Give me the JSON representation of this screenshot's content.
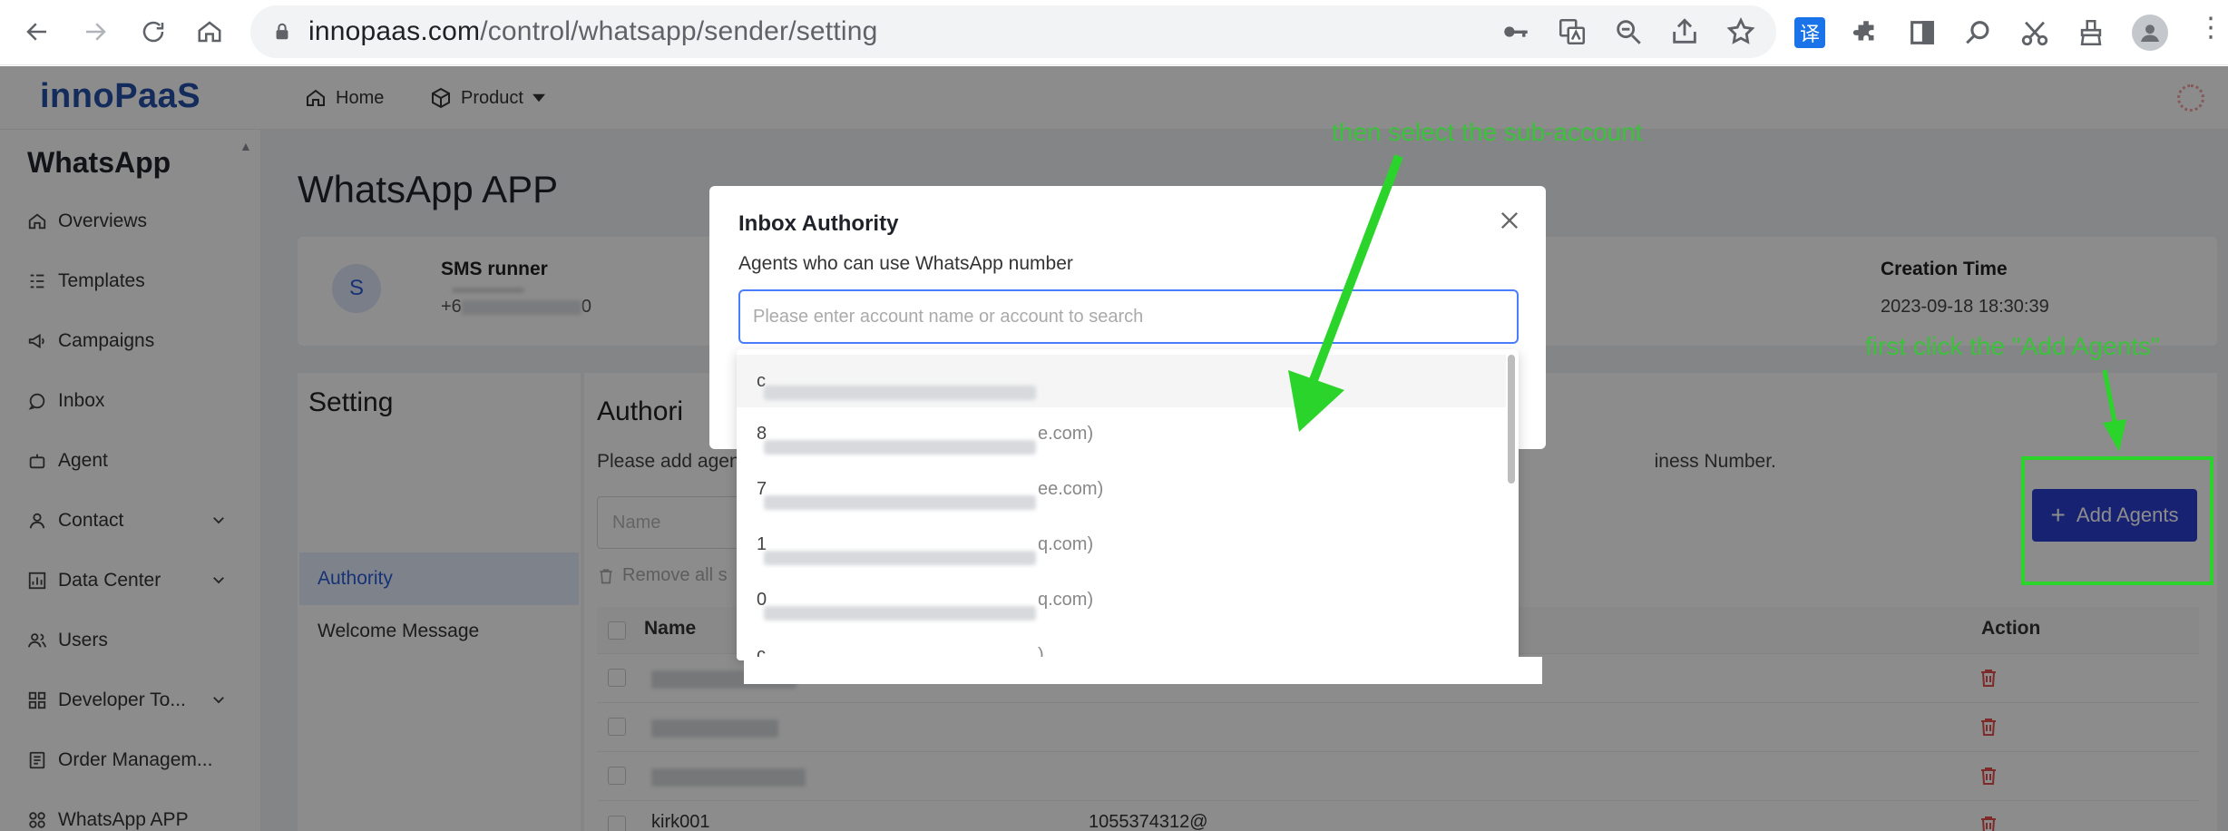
{
  "browser": {
    "url_domain": "innopaas.com",
    "url_path": "/control/whatsapp/sender/setting",
    "translate_badge": "译",
    "menu_glyph": "⋮"
  },
  "header": {
    "logo": "innoPaaS",
    "nav_home": "Home",
    "nav_product": "Product"
  },
  "sidebar": {
    "title": "WhatsApp",
    "items": [
      {
        "label": "Overviews",
        "icon": "home-icon"
      },
      {
        "label": "Templates",
        "icon": "template-icon"
      },
      {
        "label": "Campaigns",
        "icon": "megaphone-icon"
      },
      {
        "label": "Inbox",
        "icon": "chat-icon"
      },
      {
        "label": "Agent",
        "icon": "robot-icon"
      },
      {
        "label": "Contact",
        "icon": "user-icon"
      },
      {
        "label": "Data Center",
        "icon": "chart-icon"
      },
      {
        "label": "Users",
        "icon": "users-icon"
      },
      {
        "label": "Developer To...",
        "icon": "developer-icon"
      },
      {
        "label": "Order Managem...",
        "icon": "order-icon"
      },
      {
        "label": "WhatsApp APP",
        "icon": "app-icon"
      }
    ]
  },
  "main": {
    "page_title": "WhatsApp APP",
    "sender": {
      "avatar_letter": "S",
      "name": "SMS runner",
      "phone_prefix": "+6",
      "phone_suffix": "0"
    },
    "creation_time_label": "Creation Time",
    "creation_time_value": "2023-09-18 18:30:39",
    "setting_title": "Setting",
    "setting_items": [
      "Authority",
      "Welcome Message"
    ],
    "authority_title": "Authori",
    "authority_desc_start": "Please add agen",
    "authority_desc_end": "iness Number.",
    "name_placeholder": "Name",
    "remove_all": "Remove all s",
    "add_agents": "Add Agents",
    "columns": {
      "name": "Name",
      "action": "Action"
    },
    "last_row_name": "kirk001",
    "last_row_value": "1055374312@"
  },
  "modal": {
    "title": "Inbox Authority",
    "subtitle": "Agents who can use WhatsApp number",
    "search_placeholder": "Please enter account name or account to search",
    "options": [
      {
        "prefix": "c",
        "suffix": ""
      },
      {
        "prefix": "8",
        "suffix": "e.com)"
      },
      {
        "prefix": "7",
        "suffix": "ee.com)"
      },
      {
        "prefix": "1",
        "suffix": "q.com)"
      },
      {
        "prefix": "0",
        "suffix": "q.com)"
      },
      {
        "prefix": "c",
        "suffix": ")"
      }
    ]
  },
  "annotations": {
    "top": "then select the sub-account",
    "right": "first click the \"Add Agents\"",
    "color": "#3cc13c"
  }
}
